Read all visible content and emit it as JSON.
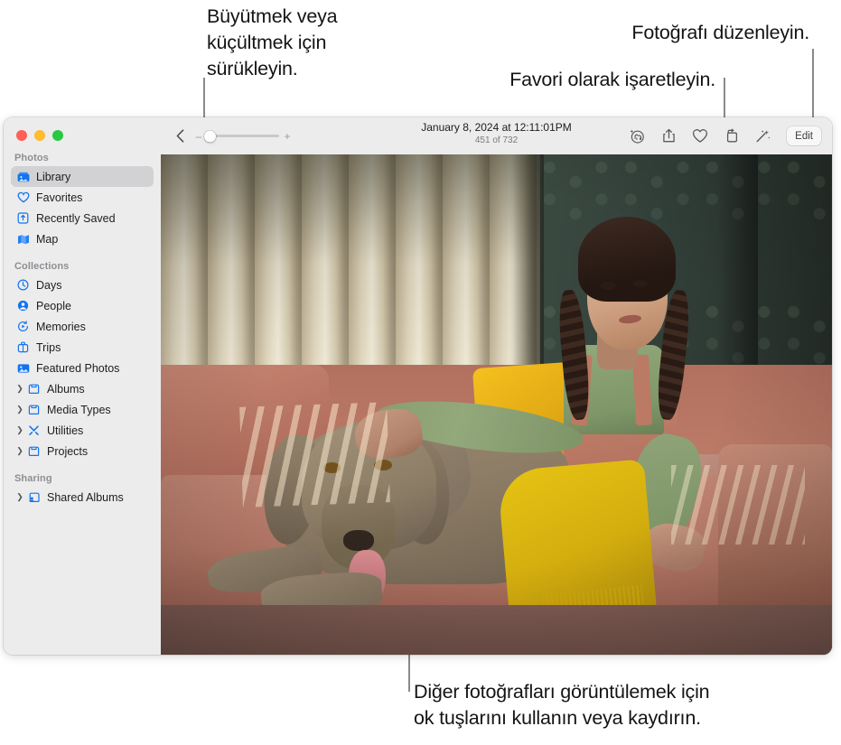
{
  "callouts": {
    "zoom": "Büyütmek veya\nküçültmek için\nsürükleyin.",
    "edit": "Fotoğrafı düzenleyin.",
    "favorite": "Favori olarak işaretleyin.",
    "browse": "Diğer fotoğrafları görüntülemek için\nok tuşlarını kullanın veya kaydırın."
  },
  "window": {
    "traffic_lights": {
      "close": "close-button",
      "minimize": "minimize-button",
      "zoom": "zoom-button",
      "colors": {
        "close": "#ff5f57",
        "minimize": "#febc2e",
        "zoom": "#28c840"
      }
    }
  },
  "sidebar": {
    "sections": [
      {
        "header": "Photos",
        "items": [
          {
            "label": "Library",
            "icon": "library-icon",
            "selected": true,
            "disclosure": false
          },
          {
            "label": "Favorites",
            "icon": "heart-icon",
            "selected": false,
            "disclosure": false
          },
          {
            "label": "Recently Saved",
            "icon": "recently-saved-icon",
            "selected": false,
            "disclosure": false
          },
          {
            "label": "Map",
            "icon": "map-icon",
            "selected": false,
            "disclosure": false
          }
        ]
      },
      {
        "header": "Collections",
        "items": [
          {
            "label": "Days",
            "icon": "clock-icon",
            "selected": false,
            "disclosure": false
          },
          {
            "label": "People",
            "icon": "person-circle-icon",
            "selected": false,
            "disclosure": false
          },
          {
            "label": "Memories",
            "icon": "memories-icon",
            "selected": false,
            "disclosure": false
          },
          {
            "label": "Trips",
            "icon": "suitcase-icon",
            "selected": false,
            "disclosure": false
          },
          {
            "label": "Featured Photos",
            "icon": "featured-photos-icon",
            "selected": false,
            "disclosure": false
          },
          {
            "label": "Albums",
            "icon": "album-icon",
            "selected": false,
            "disclosure": true
          },
          {
            "label": "Media Types",
            "icon": "album-icon",
            "selected": false,
            "disclosure": true
          },
          {
            "label": "Utilities",
            "icon": "utilities-icon",
            "selected": false,
            "disclosure": true
          },
          {
            "label": "Projects",
            "icon": "album-icon",
            "selected": false,
            "disclosure": true
          }
        ]
      },
      {
        "header": "Sharing",
        "items": [
          {
            "label": "Shared Albums",
            "icon": "shared-album-icon",
            "selected": false,
            "disclosure": true
          }
        ]
      }
    ]
  },
  "toolbar": {
    "back_label": "‹",
    "zoom_out_sign": "–",
    "zoom_in_sign": "+",
    "zoom_value": 0,
    "title": "January 8, 2024 at 12:11:01PM",
    "subtitle": "451 of 732",
    "actions": [
      {
        "name": "visual-lookup-icon",
        "label": ""
      },
      {
        "name": "share-icon",
        "label": ""
      },
      {
        "name": "heart-icon",
        "label": ""
      },
      {
        "name": "rotate-icon",
        "label": ""
      },
      {
        "name": "magic-wand-icon",
        "label": ""
      }
    ],
    "edit_label": "Edit"
  },
  "photo": {
    "alt": "Girl in green top and pink overalls petting a Weimaraner dog on a pink sofa"
  }
}
